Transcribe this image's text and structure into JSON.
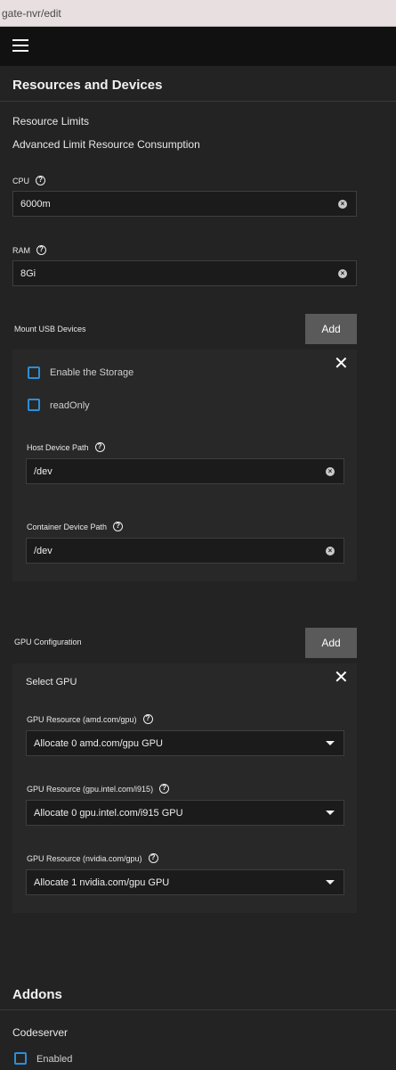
{
  "browser": {
    "url": "gate-nvr/edit"
  },
  "resources": {
    "title": "Resources and Devices",
    "limits_label": "Resource Limits",
    "advanced_label": "Advanced Limit Resource Consumption",
    "cpu": {
      "label": "CPU",
      "value": "6000m"
    },
    "ram": {
      "label": "RAM",
      "value": "8Gi"
    }
  },
  "usb": {
    "label": "Mount USB Devices",
    "add_label": "Add",
    "enable_storage_label": "Enable the Storage",
    "readonly_label": "readOnly",
    "host_path": {
      "label": "Host Device Path",
      "value": "/dev"
    },
    "container_path": {
      "label": "Container Device Path",
      "value": "/dev"
    }
  },
  "gpu": {
    "label": "GPU Configuration",
    "add_label": "Add",
    "select_label": "Select GPU",
    "amd": {
      "label": "GPU Resource (amd.com/gpu)",
      "value": "Allocate 0 amd.com/gpu GPU"
    },
    "intel": {
      "label": "GPU Resource (gpu.intel.com/i915)",
      "value": "Allocate 0 gpu.intel.com/i915 GPU"
    },
    "nvidia": {
      "label": "GPU Resource (nvidia.com/gpu)",
      "value": "Allocate 1 nvidia.com/gpu GPU"
    }
  },
  "addons": {
    "title": "Addons",
    "codeserver_label": "Codeserver",
    "enabled_label": "Enabled"
  },
  "icons": {
    "help": "?",
    "clear": "×",
    "close": "✕"
  }
}
